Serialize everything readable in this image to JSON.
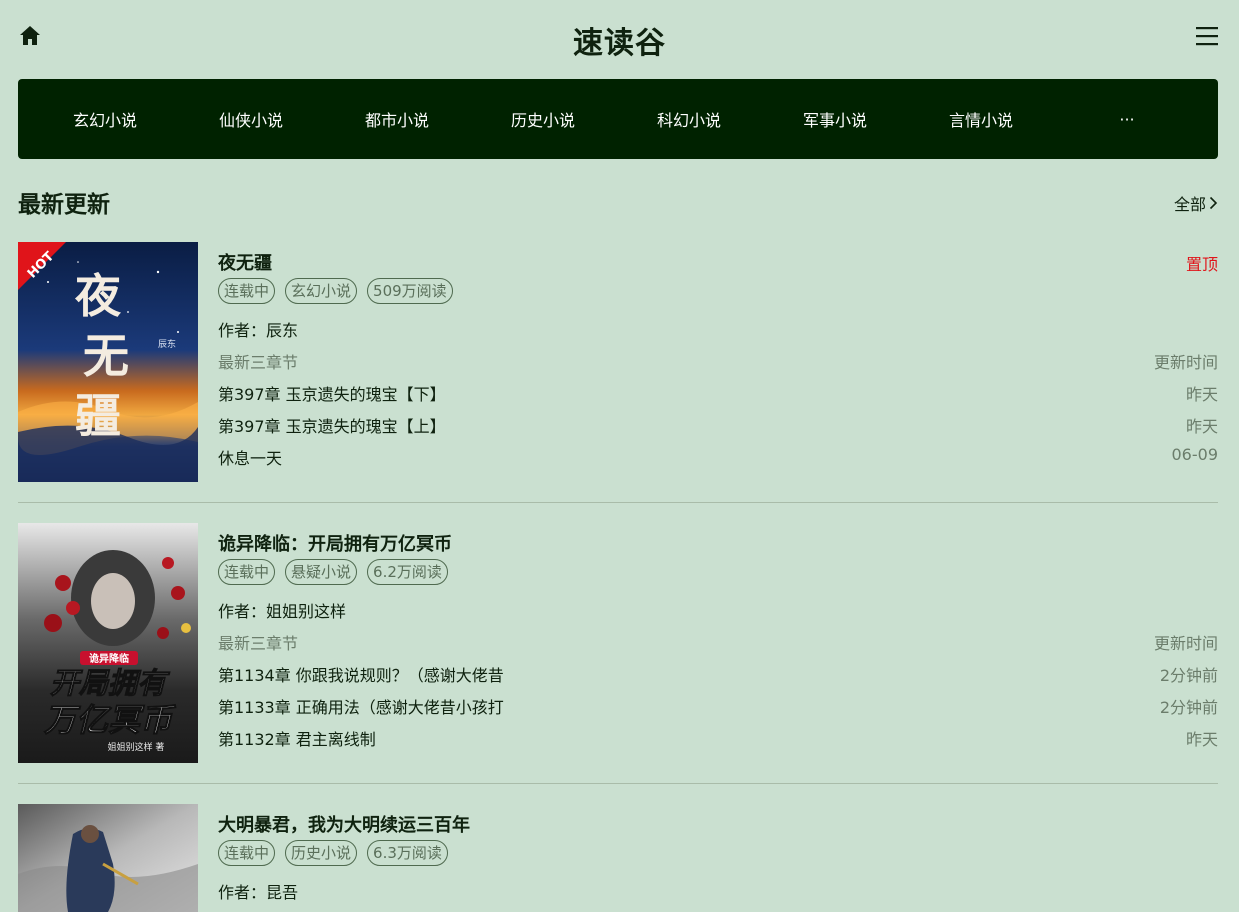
{
  "header": {
    "site_title": "速读谷",
    "home_icon": "home-icon",
    "menu_icon": "menu-icon"
  },
  "nav": {
    "items": [
      "玄幻小说",
      "仙侠小说",
      "都市小说",
      "历史小说",
      "科幻小说",
      "军事小说",
      "言情小说",
      "···"
    ]
  },
  "section": {
    "title": "最新更新",
    "more_label": "全部"
  },
  "colors": {
    "background": "#cae0d0",
    "nav_bg": "#002200",
    "pin": "#e0141a",
    "muted": "#6b7d6b"
  },
  "books": [
    {
      "title": "夜无疆",
      "pin_label": "置顶",
      "badge": "HOT",
      "cover_text": "夜无疆",
      "cover_author": "辰东",
      "tags": [
        "连载中",
        "玄幻小说",
        "509万阅读"
      ],
      "author": "作者：辰东",
      "chapters_header": "最新三章节",
      "time_header": "更新时间",
      "chapters": [
        {
          "name": "第397章 玉京遗失的瑰宝【下】",
          "time": "昨天"
        },
        {
          "name": "第397章 玉京遗失的瑰宝【上】",
          "time": "昨天"
        },
        {
          "name": "休息一天",
          "time": "06-09"
        }
      ]
    },
    {
      "title": "诡异降临：开局拥有万亿冥币",
      "cover_badge": "诡异降临",
      "cover_line1": "开局拥有",
      "cover_line2": "万亿冥币",
      "cover_author": "姐姐别这样 著",
      "tags": [
        "连载中",
        "悬疑小说",
        "6.2万阅读"
      ],
      "author": "作者：姐姐别这样",
      "chapters_header": "最新三章节",
      "time_header": "更新时间",
      "chapters": [
        {
          "name": "第1134章 你跟我说规则？（感谢大佬昔",
          "time": "2分钟前"
        },
        {
          "name": "第1133章 正确用法（感谢大佬昔小孩打",
          "time": "2分钟前"
        },
        {
          "name": "第1132章 君主离线制",
          "time": "昨天"
        }
      ]
    },
    {
      "title": "大明暴君，我为大明续运三百年",
      "tags": [
        "连载中",
        "历史小说",
        "6.3万阅读"
      ],
      "author": "作者：昆吾"
    }
  ]
}
